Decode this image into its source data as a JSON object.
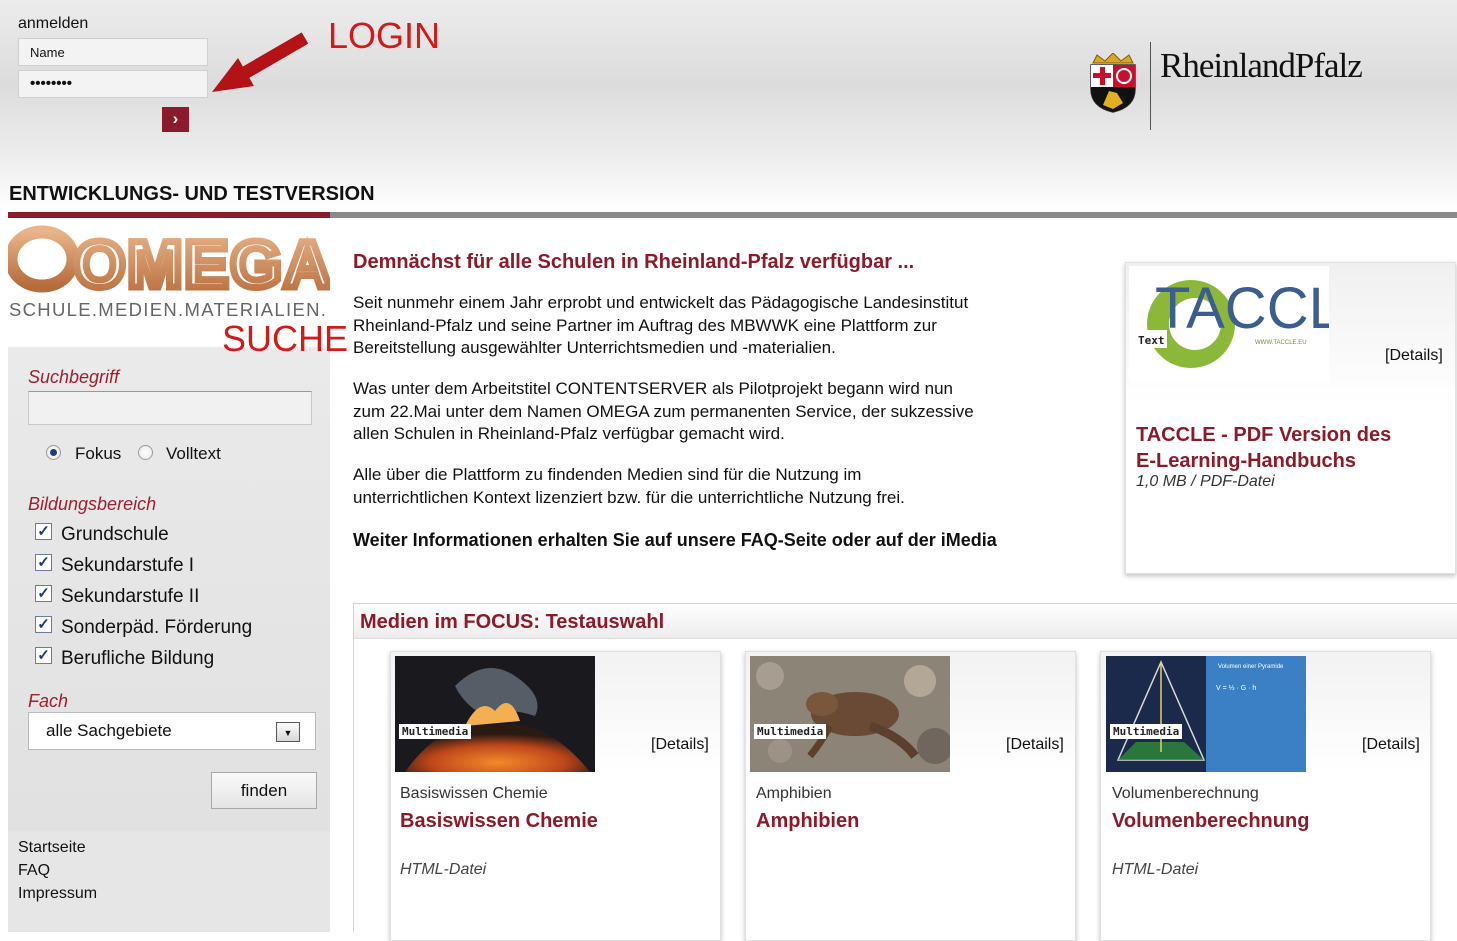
{
  "login": {
    "label": "anmelden",
    "name_value": "Name",
    "password_value": "••••••••",
    "submit_icon": "chevron-right-icon"
  },
  "annotations": {
    "login": "LOGIN",
    "search": "SUCHE"
  },
  "brand": {
    "wordmark": "RheinlandPfalz",
    "coat_of_arms": "coat-of-arms-icon"
  },
  "version_banner": "ENTWICKLUNGS- UND TESTVERSION",
  "logo": {
    "name": "OMEGA",
    "tagline": "SCHULE.MEDIEN.MATERIALIEN."
  },
  "search": {
    "heading": "Suchbegriff",
    "value": "",
    "mode_focus": "Fokus",
    "mode_fulltext": "Volltext",
    "selected_mode": "Fokus"
  },
  "education": {
    "heading": "Bildungsbereich",
    "items": [
      {
        "label": "Grundschule",
        "checked": true
      },
      {
        "label": "Sekundarstufe I",
        "checked": true
      },
      {
        "label": "Sekundarstufe II",
        "checked": true
      },
      {
        "label": "Sonderpäd. Förderung",
        "checked": true
      },
      {
        "label": "Berufliche Bildung",
        "checked": true
      }
    ]
  },
  "subject": {
    "heading": "Fach",
    "selected": "alle Sachgebiete"
  },
  "find_button": "finden",
  "nav": {
    "home": "Startseite",
    "faq": "FAQ",
    "imprint": "Impressum"
  },
  "news": {
    "title": "Demnächst für alle Schulen in Rheinland-Pfalz verfügbar ...",
    "p1_l1": "Seit nunmehr einem Jahr erprobt und entwickelt das Pädagogische Landesinstitut",
    "p1_l2": "Rheinland-Pfalz und seine Partner im Auftrag des MBWWK eine Plattform zur",
    "p1_l3": "Bereitstellung ausgewählter Unterrichtsmedien und -materialien.",
    "p2_l1": "Was unter dem Arbeitstitel CONTENTSERVER als Pilotprojekt begann wird nun",
    "p2_l2": "zum 22.Mai unter dem Namen OMEGA zum permanenten Service, der sukzessive",
    "p2_l3": "allen Schulen in Rheinland-Pfalz verfügbar gemacht wird.",
    "p3_l1": "Alle über die Plattform zu findenden Medien sind für die Nutzung im",
    "p3_l2": "unterrichtlichen Kontext lizenziert bzw. für die unterrichtliche Nutzung frei.",
    "p4": "Weiter Informationen erhalten Sie auf unsere FAQ-Seite oder auf der iMedia"
  },
  "featured": {
    "logo_word": "TACCLE",
    "logo_badge": "Text",
    "logo_url_text": "WWW.TACCLE.EU",
    "details": "[Details]",
    "title_l1": "TACCLE - PDF Version des",
    "title_l2": "E-Learning-Handbuchs",
    "meta": "1,0 MB / PDF-Datei"
  },
  "focus": {
    "title": "Medien im FOCUS: Testauswahl",
    "items": [
      {
        "badge": "Multimedia",
        "details": "[Details]",
        "category": "Basiswissen Chemie",
        "title": "Basiswissen Chemie",
        "type": "HTML-Datei"
      },
      {
        "badge": "Multimedia",
        "details": "[Details]",
        "category": "Amphibien",
        "title": "Amphibien",
        "type": ""
      },
      {
        "badge": "Multimedia",
        "details": "[Details]",
        "category": "Volumenberechnung",
        "title": "Volumenberechnung",
        "type": "HTML-Datei",
        "thumb_text_1": "Volumen einer Pyramide",
        "thumb_text_2": "V = ⅓ · G · h"
      }
    ]
  },
  "colors": {
    "accent": "#8b1a2a",
    "annotation": "#d11a1a",
    "divider": "#8a8a8a"
  }
}
